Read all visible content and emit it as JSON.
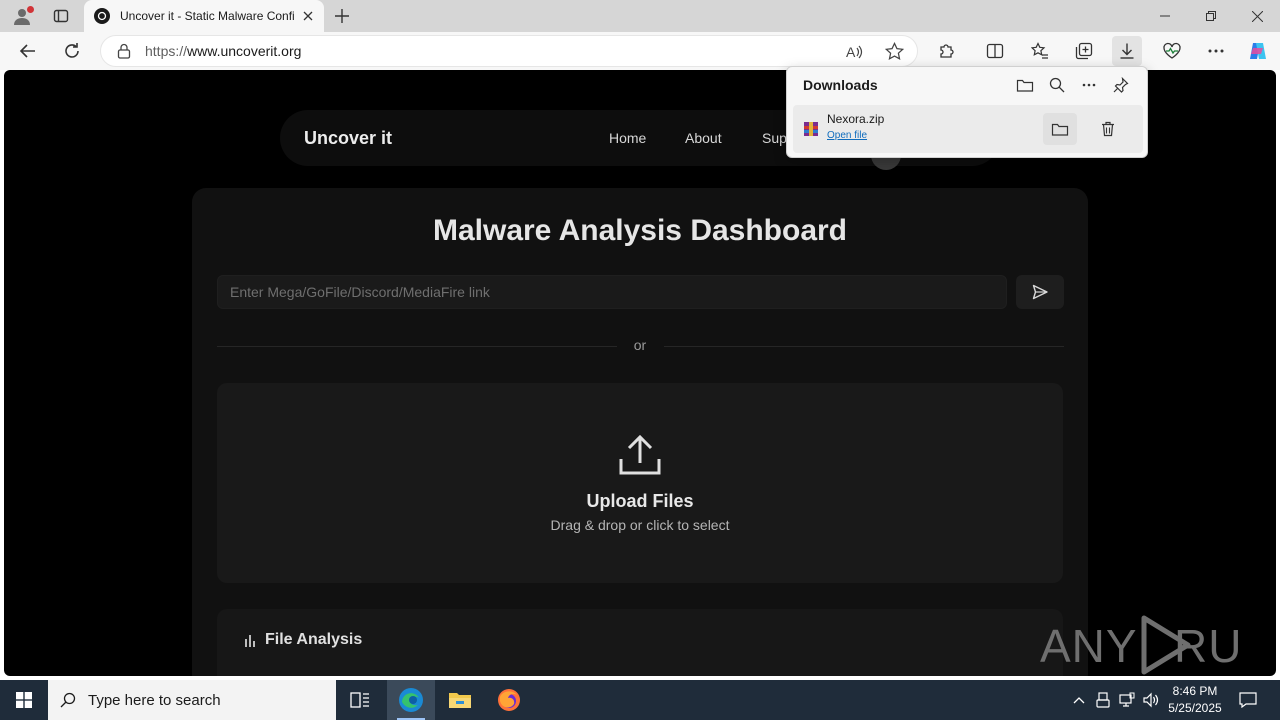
{
  "browser": {
    "tab_title": "Uncover it - Static Malware Confi",
    "url_protocol": "https://",
    "url_host": "www.uncoverit.org"
  },
  "site": {
    "brand": "Uncover it",
    "nav": [
      "Home",
      "About",
      "Sup"
    ]
  },
  "dashboard": {
    "heading": "Malware Analysis Dashboard",
    "link_placeholder": "Enter Mega/GoFile/Discord/MediaFire link",
    "or_text": "or",
    "upload_title": "Upload Files",
    "upload_subtitle": "Drag & drop or click to select",
    "analysis_title": "File Analysis"
  },
  "downloads": {
    "title": "Downloads",
    "items": [
      {
        "file_name": "Nexora.zip",
        "action": "Open file"
      }
    ]
  },
  "watermark": "ANY RUN",
  "taskbar": {
    "search_placeholder": "Type here to search",
    "time": "8:46 PM",
    "date": "5/25/2025"
  },
  "colors": {
    "page_bg": "#000000",
    "panel_bg": "#111111",
    "taskbar_bg": "#1f2c3a",
    "link_blue": "#0f6cbd"
  }
}
